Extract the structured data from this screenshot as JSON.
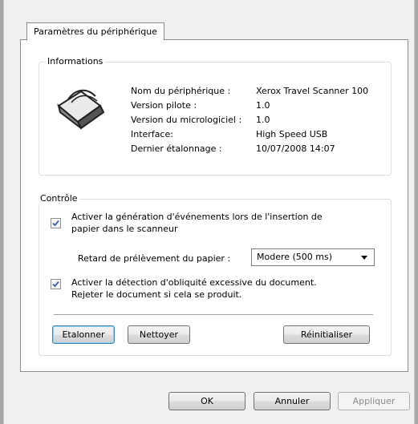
{
  "tab": {
    "label": "Paramètres du périphérique"
  },
  "info": {
    "title": "Informations",
    "rows": [
      {
        "label": "Nom du périphérique :",
        "value": "Xerox Travel Scanner 100"
      },
      {
        "label": "Version pilote :",
        "value": "1.0"
      },
      {
        "label": "Version du micrologiciel :",
        "value": "1.0"
      },
      {
        "label": "Interface:",
        "value": "High Speed USB"
      },
      {
        "label": "Dernier étalonnage :",
        "value": "10/07/2008  14:07"
      }
    ]
  },
  "control": {
    "title": "Contrôle",
    "event_checkbox": {
      "checked": true,
      "line1": "Activer la génération d'événements lors de l'insertion de",
      "line2": "papier dans le scanneur"
    },
    "delay_label": "Retard de prélèvement du papier :",
    "delay_value": "Modere (500 ms)",
    "skew_checkbox": {
      "checked": true,
      "line1": "Activer la détection d'obliquité excessive du document.",
      "line2": "Rejeter le document si cela se produit."
    },
    "buttons": {
      "calibrate": "Etalonner",
      "clean": "Nettoyer",
      "reset": "Réinitialiser"
    }
  },
  "footer": {
    "ok": "OK",
    "cancel": "Annuler",
    "apply": "Appliquer"
  },
  "colors": {
    "check": "#3a5fa8",
    "group_border": "#d5dfe5"
  }
}
